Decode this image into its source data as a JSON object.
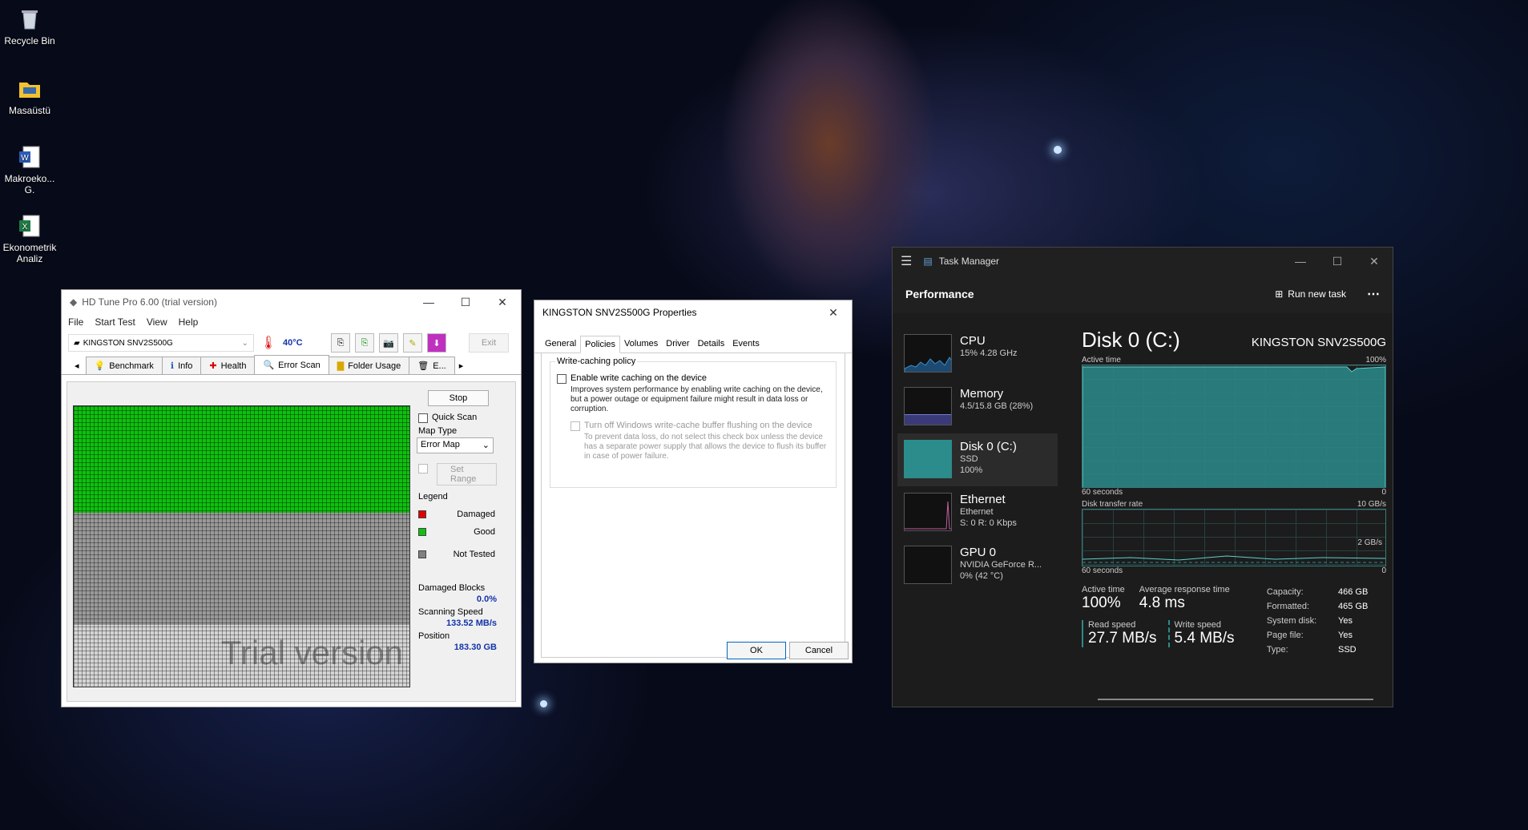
{
  "desktop": {
    "icons": [
      {
        "label": "Recycle Bin"
      },
      {
        "label": "Masaüstü"
      },
      {
        "label": "Makroeko... G."
      },
      {
        "label": "Ekonometrik Analiz"
      }
    ]
  },
  "hdtune": {
    "title": "HD Tune Pro 6.00 (trial version)",
    "menu": [
      "File",
      "Start Test",
      "View",
      "Help"
    ],
    "drive": "KINGSTON SNV2S500G",
    "temp": "40°C",
    "exit_label": "Exit",
    "tabs": [
      "Benchmark",
      "Info",
      "Health",
      "Error Scan",
      "Folder Usage",
      "E..."
    ],
    "stop_label": "Stop",
    "quick_scan_label": "Quick Scan",
    "map_type_label": "Map Type",
    "map_type_value": "Error Map",
    "set_range_label": "Set Range",
    "legend_label": "Legend",
    "legend": [
      "Damaged",
      "Good",
      "Not Tested"
    ],
    "damaged_blocks_label": "Damaged Blocks",
    "damaged_blocks_value": "0.0%",
    "scanning_speed_label": "Scanning Speed",
    "scanning_speed_value": "133.52 MB/s",
    "position_label": "Position",
    "position_value": "183.30 GB",
    "watermark": "Trial version",
    "scan_progress": 0.38,
    "colors": {
      "good": "#10c010",
      "not_tested": "#9a9a9a",
      "damaged": "#e00000"
    }
  },
  "props": {
    "title": "KINGSTON SNV2S500G Properties",
    "tabs": [
      "General",
      "Policies",
      "Volumes",
      "Driver",
      "Details",
      "Events"
    ],
    "group_title": "Write-caching policy",
    "opt1_label": "Enable write caching on the device",
    "opt1_desc": "Improves system performance by enabling write caching on the device, but a power outage or equipment failure might result in data loss or corruption.",
    "opt2_label": "Turn off Windows write-cache buffer flushing on the device",
    "opt2_desc": "To prevent data loss, do not select this check box unless the device has a separate power supply that allows the device to flush its buffer in case of power failure.",
    "ok_label": "OK",
    "cancel_label": "Cancel"
  },
  "taskmgr": {
    "title": "Task Manager",
    "section": "Performance",
    "run_task": "Run new task",
    "items": [
      {
        "name": "CPU",
        "l1": "15% 4.28 GHz",
        "l2": ""
      },
      {
        "name": "Memory",
        "l1": "4.5/15.8 GB (28%)",
        "l2": ""
      },
      {
        "name": "Disk 0 (C:)",
        "l1": "SSD",
        "l2": "100%"
      },
      {
        "name": "Ethernet",
        "l1": "Ethernet",
        "l2": "S: 0 R: 0 Kbps"
      },
      {
        "name": "GPU 0",
        "l1": "NVIDIA GeForce R...",
        "l2": "0% (42 °C)"
      }
    ],
    "disk_title": "Disk 0 (C:)",
    "disk_model": "KINGSTON SNV2S500G",
    "active_time_label": "Active time",
    "active_max": "100%",
    "sixty": "60 seconds",
    "zero": "0",
    "transfer_label": "Disk transfer rate",
    "transfer_max": "10 GB/s",
    "transfer_mid": "2 GB/s",
    "active_time_stat_label": "Active time",
    "active_time_stat": "100%",
    "resp_label": "Average response time",
    "resp_value": "4.8 ms",
    "read_label": "Read speed",
    "read_value": "27.7 MB/s",
    "write_label": "Write speed",
    "write_value": "5.4 MB/s",
    "kv": [
      {
        "k": "Capacity:",
        "v": "466 GB"
      },
      {
        "k": "Formatted:",
        "v": "465 GB"
      },
      {
        "k": "System disk:",
        "v": "Yes"
      },
      {
        "k": "Page file:",
        "v": "Yes"
      },
      {
        "k": "Type:",
        "v": "SSD"
      }
    ],
    "colors": {
      "disk": "#2c8b8b",
      "cpu": "#3a8fd0",
      "memory": "#5a5aa8",
      "ethernet": "#c060a0"
    }
  }
}
